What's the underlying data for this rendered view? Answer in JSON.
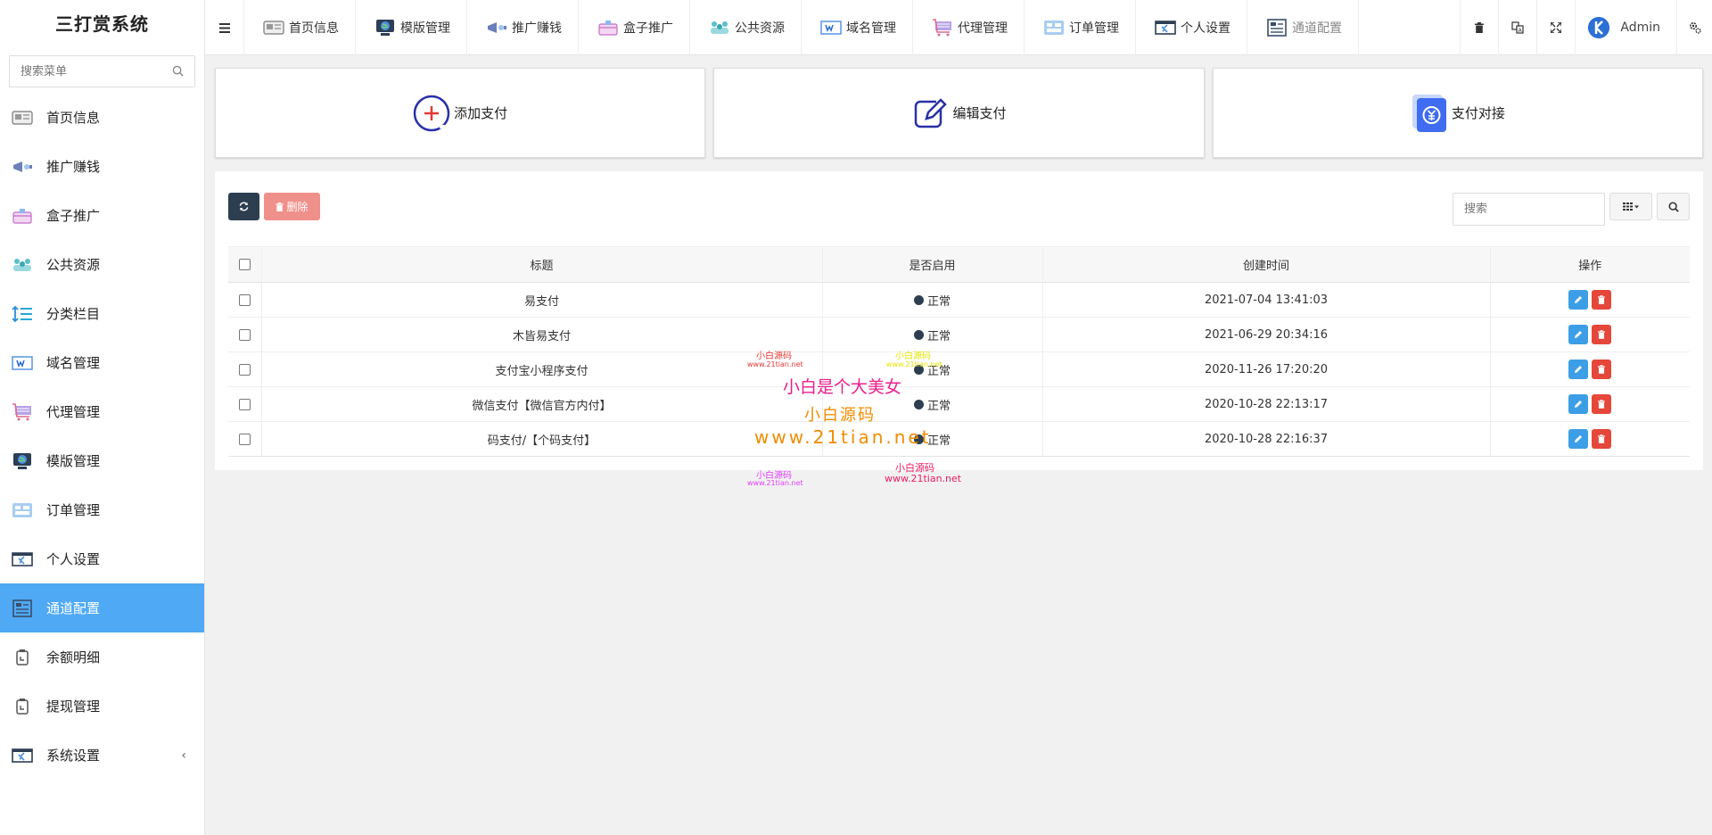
{
  "app_title": "三打赏系统",
  "sidebar": {
    "search_placeholder": "搜索菜单",
    "items": [
      {
        "label": "首页信息",
        "icon": "home-card-icon"
      },
      {
        "label": "推广赚钱",
        "icon": "promo-icon"
      },
      {
        "label": "盒子推广",
        "icon": "box-icon"
      },
      {
        "label": "公共资源",
        "icon": "resource-icon"
      },
      {
        "label": "分类栏目",
        "icon": "category-icon"
      },
      {
        "label": "域名管理",
        "icon": "domain-icon"
      },
      {
        "label": "代理管理",
        "icon": "cart-icon"
      },
      {
        "label": "模版管理",
        "icon": "template-icon"
      },
      {
        "label": "订单管理",
        "icon": "order-icon"
      },
      {
        "label": "个人设置",
        "icon": "profile-icon"
      },
      {
        "label": "通道配置",
        "icon": "channel-icon",
        "active": true
      },
      {
        "label": "余额明细",
        "icon": "balance-icon"
      },
      {
        "label": "提现管理",
        "icon": "withdraw-icon"
      },
      {
        "label": "系统设置",
        "icon": "system-icon",
        "chevron": "‹"
      }
    ]
  },
  "topbar": {
    "tabs": [
      {
        "label": "首页信息",
        "icon": "home-card-icon"
      },
      {
        "label": "模版管理",
        "icon": "template-icon"
      },
      {
        "label": "推广赚钱",
        "icon": "promo-icon"
      },
      {
        "label": "盒子推广",
        "icon": "box-icon"
      },
      {
        "label": "公共资源",
        "icon": "resource-icon"
      },
      {
        "label": "域名管理",
        "icon": "domain-icon"
      },
      {
        "label": "代理管理",
        "icon": "cart-icon"
      },
      {
        "label": "订单管理",
        "icon": "order-icon"
      },
      {
        "label": "个人设置",
        "icon": "profile-icon"
      },
      {
        "label": "通道配置",
        "icon": "channel-icon"
      }
    ],
    "user": "Admin"
  },
  "cards": [
    {
      "label": "添加支付",
      "icon": "add-circle-icon"
    },
    {
      "label": "编辑支付",
      "icon": "edit-icon"
    },
    {
      "label": "支付对接",
      "icon": "yen-book-icon"
    }
  ],
  "toolbar": {
    "delete_label": "删除",
    "search_placeholder": "搜索"
  },
  "table": {
    "columns": [
      "标题",
      "是否启用",
      "创建时间",
      "操作"
    ],
    "rows": [
      {
        "title": "易支付",
        "status": "正常",
        "created": "2021-07-04 13:41:03"
      },
      {
        "title": "木皆易支付",
        "status": "正常",
        "created": "2021-06-29 20:34:16"
      },
      {
        "title": "支付宝小程序支付",
        "status": "正常",
        "created": "2020-11-26 17:20:20"
      },
      {
        "title": "微信支付【微信官方内付】",
        "status": "正常",
        "created": "2020-10-28 22:13:17"
      },
      {
        "title": "码支付/【个码支付】",
        "status": "正常",
        "created": "2020-10-28 22:16:37"
      }
    ]
  },
  "watermark": {
    "line1": "小白源码",
    "line2": "www.21tian.net",
    "main": "小白是个大美女",
    "line3": "小白源码",
    "line4": "www.21tian.net"
  },
  "colors": {
    "active_menu": "#4fa9f4",
    "refresh_btn": "#2c3e50",
    "delete_btn": "#f0908a",
    "edit_op": "#3c9ee6",
    "delete_op": "#e5473a"
  }
}
